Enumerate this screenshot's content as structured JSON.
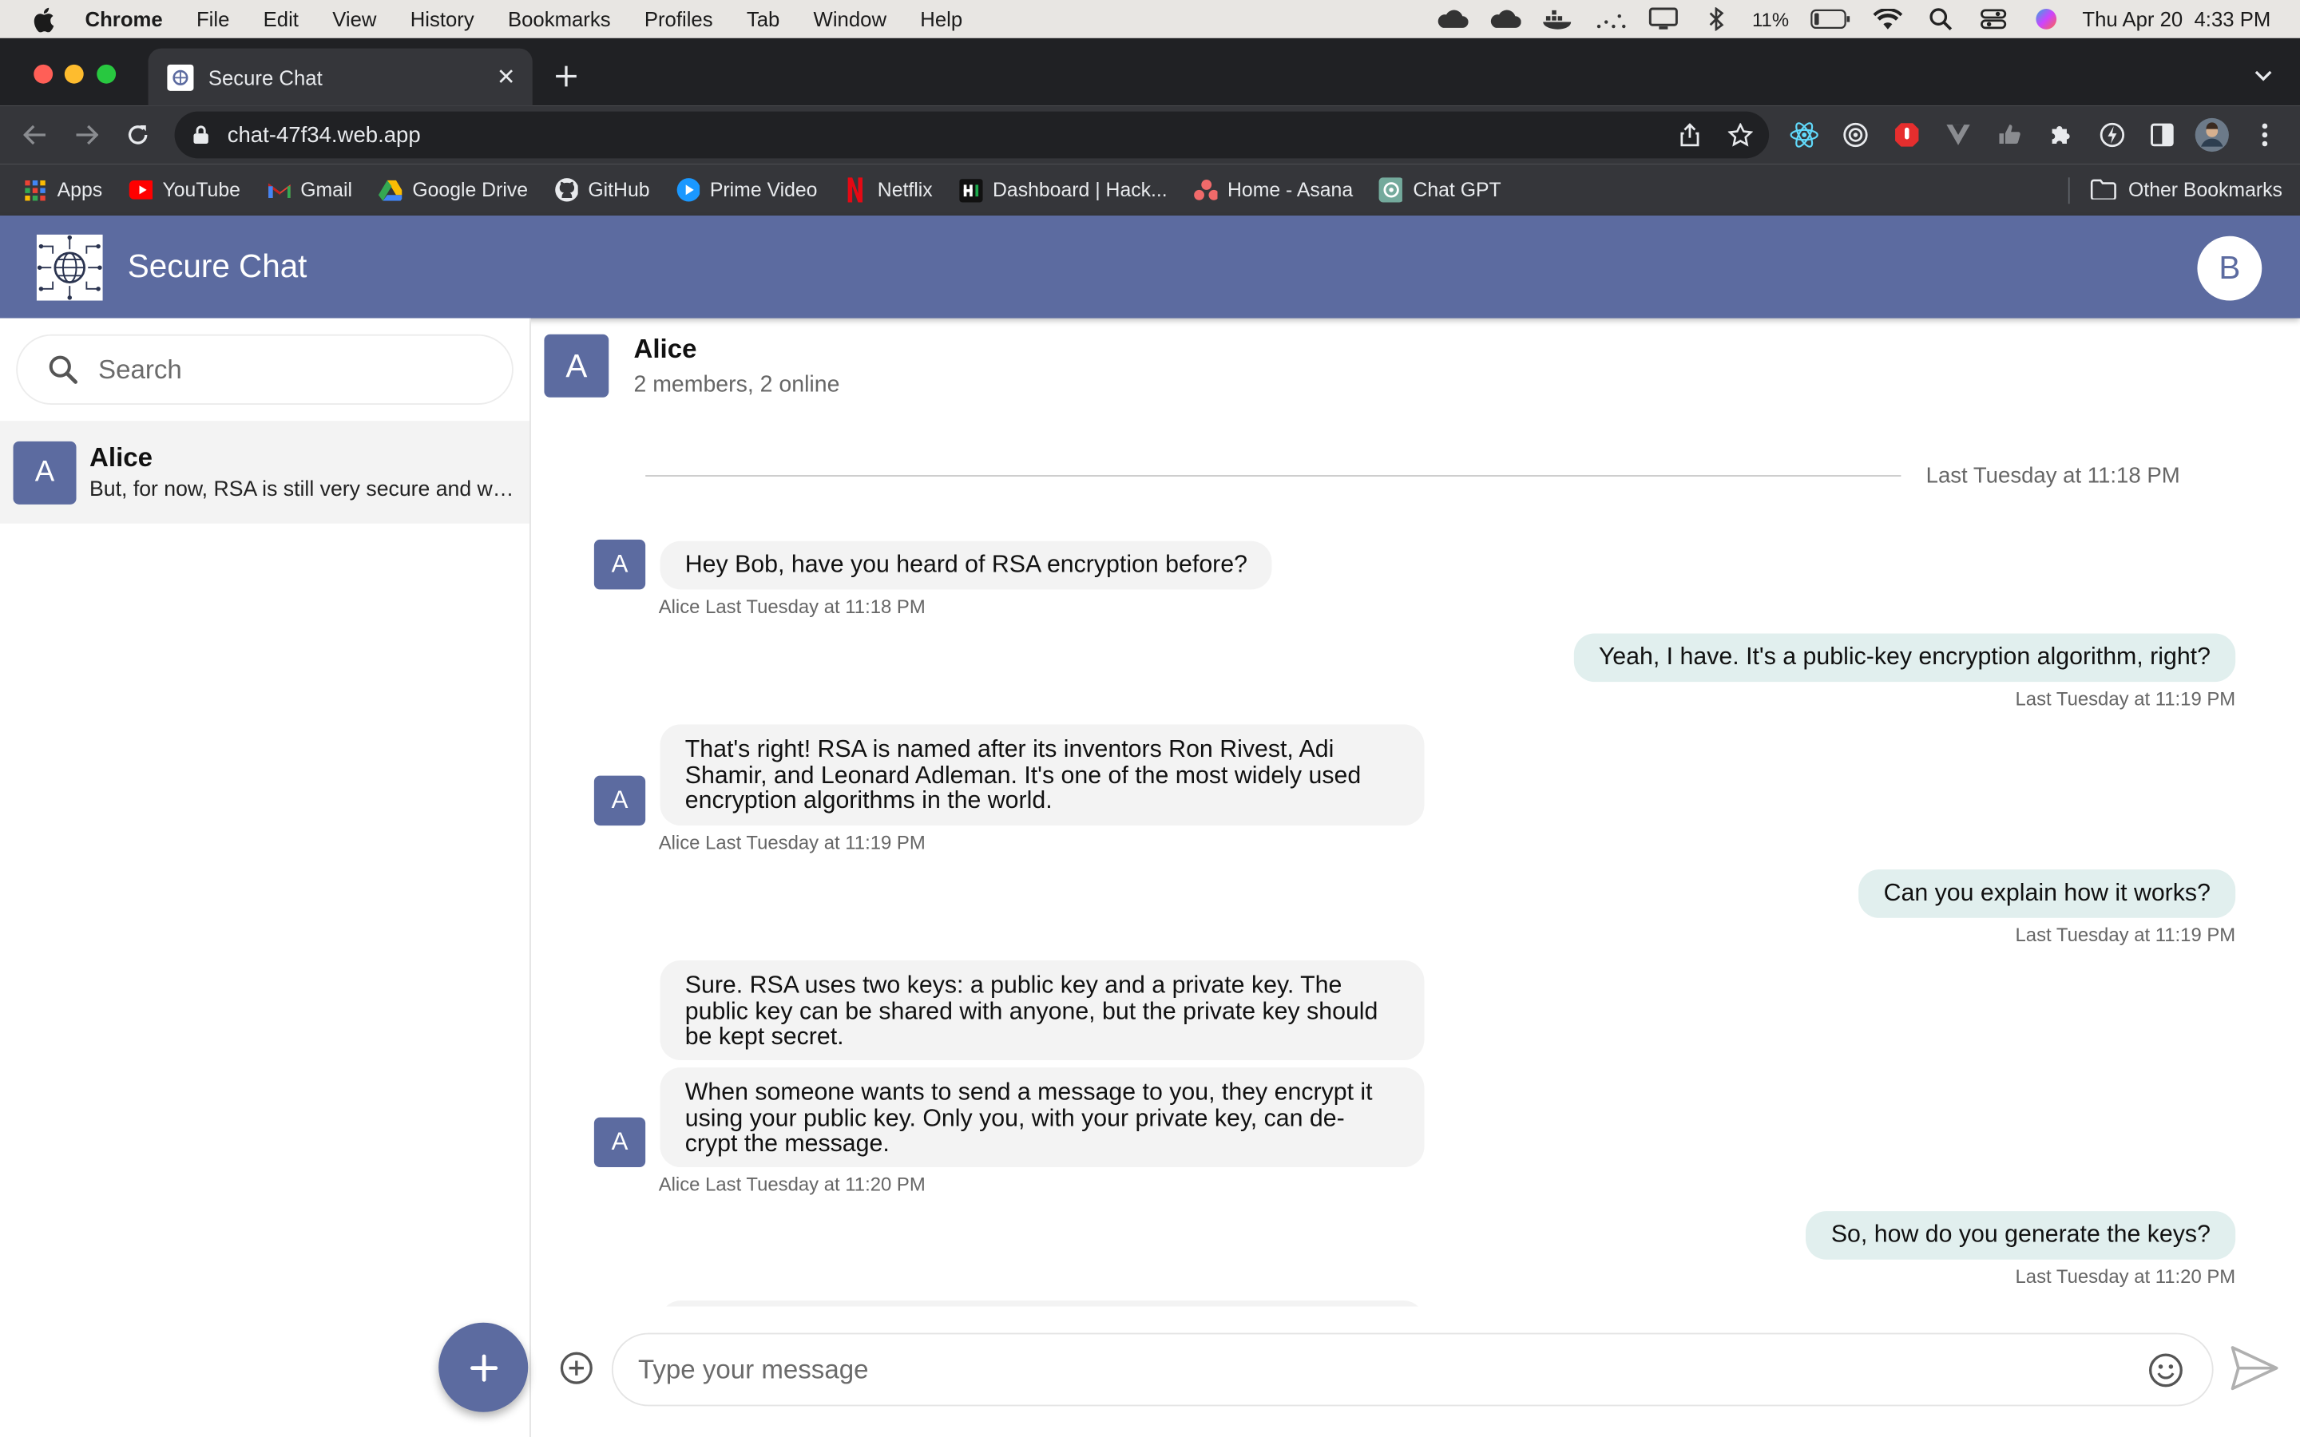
{
  "menubar": {
    "app": "Chrome",
    "items": [
      "File",
      "Edit",
      "View",
      "History",
      "Bookmarks",
      "Profiles",
      "Tab",
      "Window",
      "Help"
    ],
    "battery": "11%",
    "datetime": "Thu Apr 20  4:33 PM"
  },
  "browser": {
    "tab_title": "Secure Chat",
    "url": "chat-47f34.web.app",
    "bookmarks": [
      {
        "label": "Apps",
        "icon": "apps-grid-icon",
        "color": "#ea4335"
      },
      {
        "label": "YouTube",
        "icon": "youtube-icon",
        "color": "#ff0000"
      },
      {
        "label": "Gmail",
        "icon": "gmail-icon",
        "color": "#ea4335"
      },
      {
        "label": "Google Drive",
        "icon": "google-drive-icon",
        "color": "#fbbc04"
      },
      {
        "label": "GitHub",
        "icon": "github-icon",
        "color": "#ffffff"
      },
      {
        "label": "Prime Video",
        "icon": "prime-video-icon",
        "color": "#1a98ff"
      },
      {
        "label": "Netflix",
        "icon": "netflix-icon",
        "color": "#e50914"
      },
      {
        "label": "Dashboard | Hack...",
        "icon": "hackerrank-icon",
        "color": "#ffffff"
      },
      {
        "label": "Home - Asana",
        "icon": "asana-icon",
        "color": "#f06a6a"
      },
      {
        "label": "Chat GPT",
        "icon": "chatgpt-icon",
        "color": "#74aa9c"
      }
    ],
    "other_bookmarks": "Other Bookmarks"
  },
  "app": {
    "title": "Secure Chat",
    "user_initial": "B",
    "accent": "#5c6ba0"
  },
  "sidebar": {
    "search_placeholder": "Search",
    "conversations": [
      {
        "initial": "A",
        "name": "Alice",
        "preview": "But, for now, RSA is still very secure and widely used."
      }
    ]
  },
  "chat": {
    "initial": "A",
    "name": "Alice",
    "meta": "2 members, 2 online",
    "divider": "Last Tuesday at 11:18 PM",
    "messages": [
      {
        "from": "Alice",
        "initial": "A",
        "text": "Hey Bob, have you heard of RSA encryption before?",
        "meta": "Alice Last Tuesday at 11:18 PM"
      },
      {
        "from": "me",
        "text": "Yeah, I have. It's a public-key encryption algorithm, right?",
        "meta": "Last Tuesday at 11:19 PM"
      },
      {
        "from": "Alice",
        "initial": "A",
        "text_lines": [
          "That's right! RSA is named after its inventors Ron Rivest, Adi",
          "Shamir, and Leonard Adleman. It's one of the most widely used",
          "encryption algorithms in the world."
        ],
        "meta": "Alice Last Tuesday at 11:19 PM"
      },
      {
        "from": "me",
        "text": "Can you explain how it works?",
        "meta": "Last Tuesday at 11:19 PM"
      },
      {
        "from": "Alice",
        "initial": "A",
        "text_lines": [
          "Sure. RSA uses two keys: a public key and a private key. The",
          "public key can be shared with anyone, but the private key should",
          "be kept secret."
        ]
      },
      {
        "from": "Alice",
        "initial": "A",
        "text_lines": [
          "When someone wants to send a message to you, they encrypt it",
          "using your public key. Only you, with your private key, can de-",
          "crypt the message."
        ],
        "meta": "Alice Last Tuesday at 11:20 PM"
      },
      {
        "from": "me",
        "text": "So, how do you generate the keys?",
        "meta": "Last Tuesday at 11:20 PM"
      }
    ],
    "composer_placeholder": "Type your message"
  }
}
